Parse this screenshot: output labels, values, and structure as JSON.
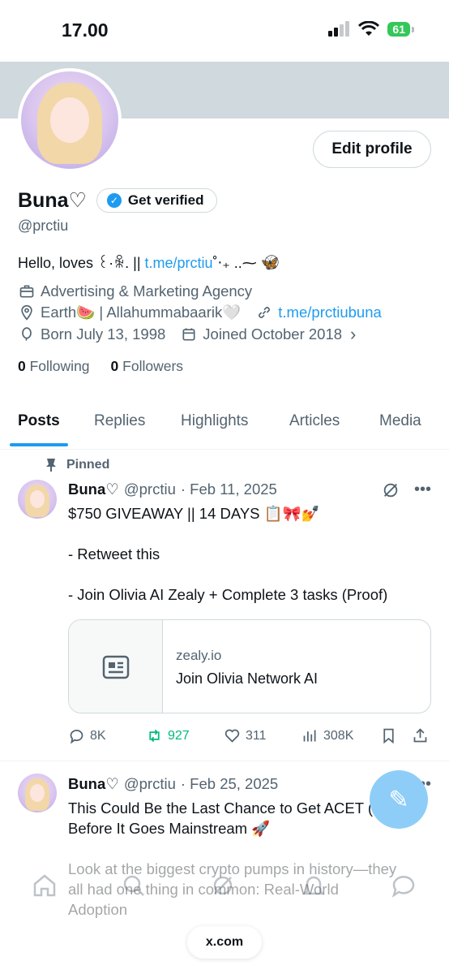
{
  "status_bar": {
    "time": "17.00",
    "battery": "61"
  },
  "profile": {
    "edit_button": "Edit profile",
    "name": "Buna♡",
    "verify_button": "Get verified",
    "handle": "@prctiu",
    "bio_text": "Hello, loves ꒰·ꆜ. || ",
    "bio_link": "t.me/prctiu",
    "bio_tail": "˚‧₊ ..⁓ 🦋⃝ ",
    "category": "Advertising & Marketing Agency",
    "location": "Earth🍉 | Allahummabaarik🤍",
    "website": "t.me/prctiubuna",
    "born": "Born July 13, 1998",
    "joined": "Joined October 2018",
    "following_count": "0",
    "following_label": "Following",
    "followers_count": "0",
    "followers_label": "Followers"
  },
  "tabs": [
    "Posts",
    "Replies",
    "Highlights",
    "Articles",
    "Media"
  ],
  "pinned_label": "Pinned",
  "posts": [
    {
      "name": "Buna♡",
      "handle": "@prctiu",
      "date": "· Feb 11, 2025",
      "lines": [
        "$750 GIVEAWAY || 14 DAYS 📋🎀💅",
        "",
        "- Retweet this",
        "",
        "- Join Olivia AI Zealy + Complete 3 tasks (Proof)"
      ],
      "card": {
        "domain": "zealy.io",
        "title": "Join Olivia Network AI"
      },
      "stats": {
        "replies": "8K",
        "reposts": "927",
        "likes": "311",
        "views": "308K"
      }
    },
    {
      "name": "Buna♡",
      "handle": "@prctiu",
      "date": "· Feb 25, 2025",
      "lines": [
        "This Could Be the Last Chance to Get ACET (ACT)",
        "Before It Goes Mainstream 🚀",
        "",
        "Look at the biggest crypto pumps in history—they",
        "all had one thing in common: Real-World",
        "Adoption"
      ]
    }
  ],
  "browser_url": "x.com",
  "colors": {
    "accent": "#1d9bf0",
    "repost_green": "#00ba7c",
    "muted": "#536471"
  }
}
